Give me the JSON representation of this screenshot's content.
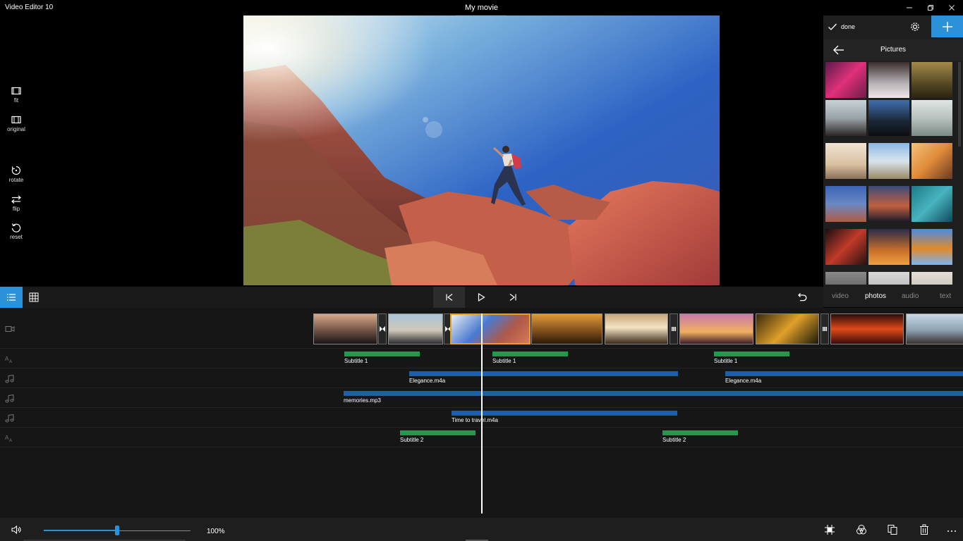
{
  "window": {
    "app_title": "Video Editor 10",
    "document_title": "My movie"
  },
  "left_tools": [
    {
      "label": "fit",
      "icon": "fit-icon"
    },
    {
      "label": "original",
      "icon": "original-icon"
    },
    {
      "label": "rotate",
      "icon": "rotate-icon"
    },
    {
      "label": "flip",
      "icon": "flip-icon"
    },
    {
      "label": "reset",
      "icon": "reset-icon"
    }
  ],
  "right_panel": {
    "done_label": "done",
    "section_title": "Pictures",
    "tabs": [
      {
        "label": "video",
        "active": false
      },
      {
        "label": "photos",
        "active": true
      },
      {
        "label": "audio",
        "active": false
      },
      {
        "label": "text",
        "active": false
      }
    ]
  },
  "timeline": {
    "text_tracks": [
      {
        "row": 0,
        "items": [
          {
            "label": "Subtitle 1"
          },
          {
            "label": "Subtitle 1"
          },
          {
            "label": "Subtitle 1"
          }
        ]
      },
      {
        "row": 4,
        "items": [
          {
            "label": "Subtitle 2"
          },
          {
            "label": "Subtitle 2"
          }
        ]
      }
    ],
    "audio_tracks": [
      {
        "row": 1,
        "items": [
          {
            "label": "Elegance.m4a"
          },
          {
            "label": "Elegance.m4a"
          }
        ]
      },
      {
        "row": 2,
        "items": [
          {
            "label": "memories.mp3"
          }
        ]
      },
      {
        "row": 3,
        "items": [
          {
            "label": "Time to travel.m4a"
          }
        ]
      }
    ]
  },
  "bottom_bar": {
    "volume_level": 0.5,
    "zoom_label": "100%"
  },
  "colors": {
    "accent": "#2b91d9",
    "text_clip": "#1f9a4f",
    "audio_clip": "#1e5fa9",
    "selected_clip": "#e8a21a"
  }
}
